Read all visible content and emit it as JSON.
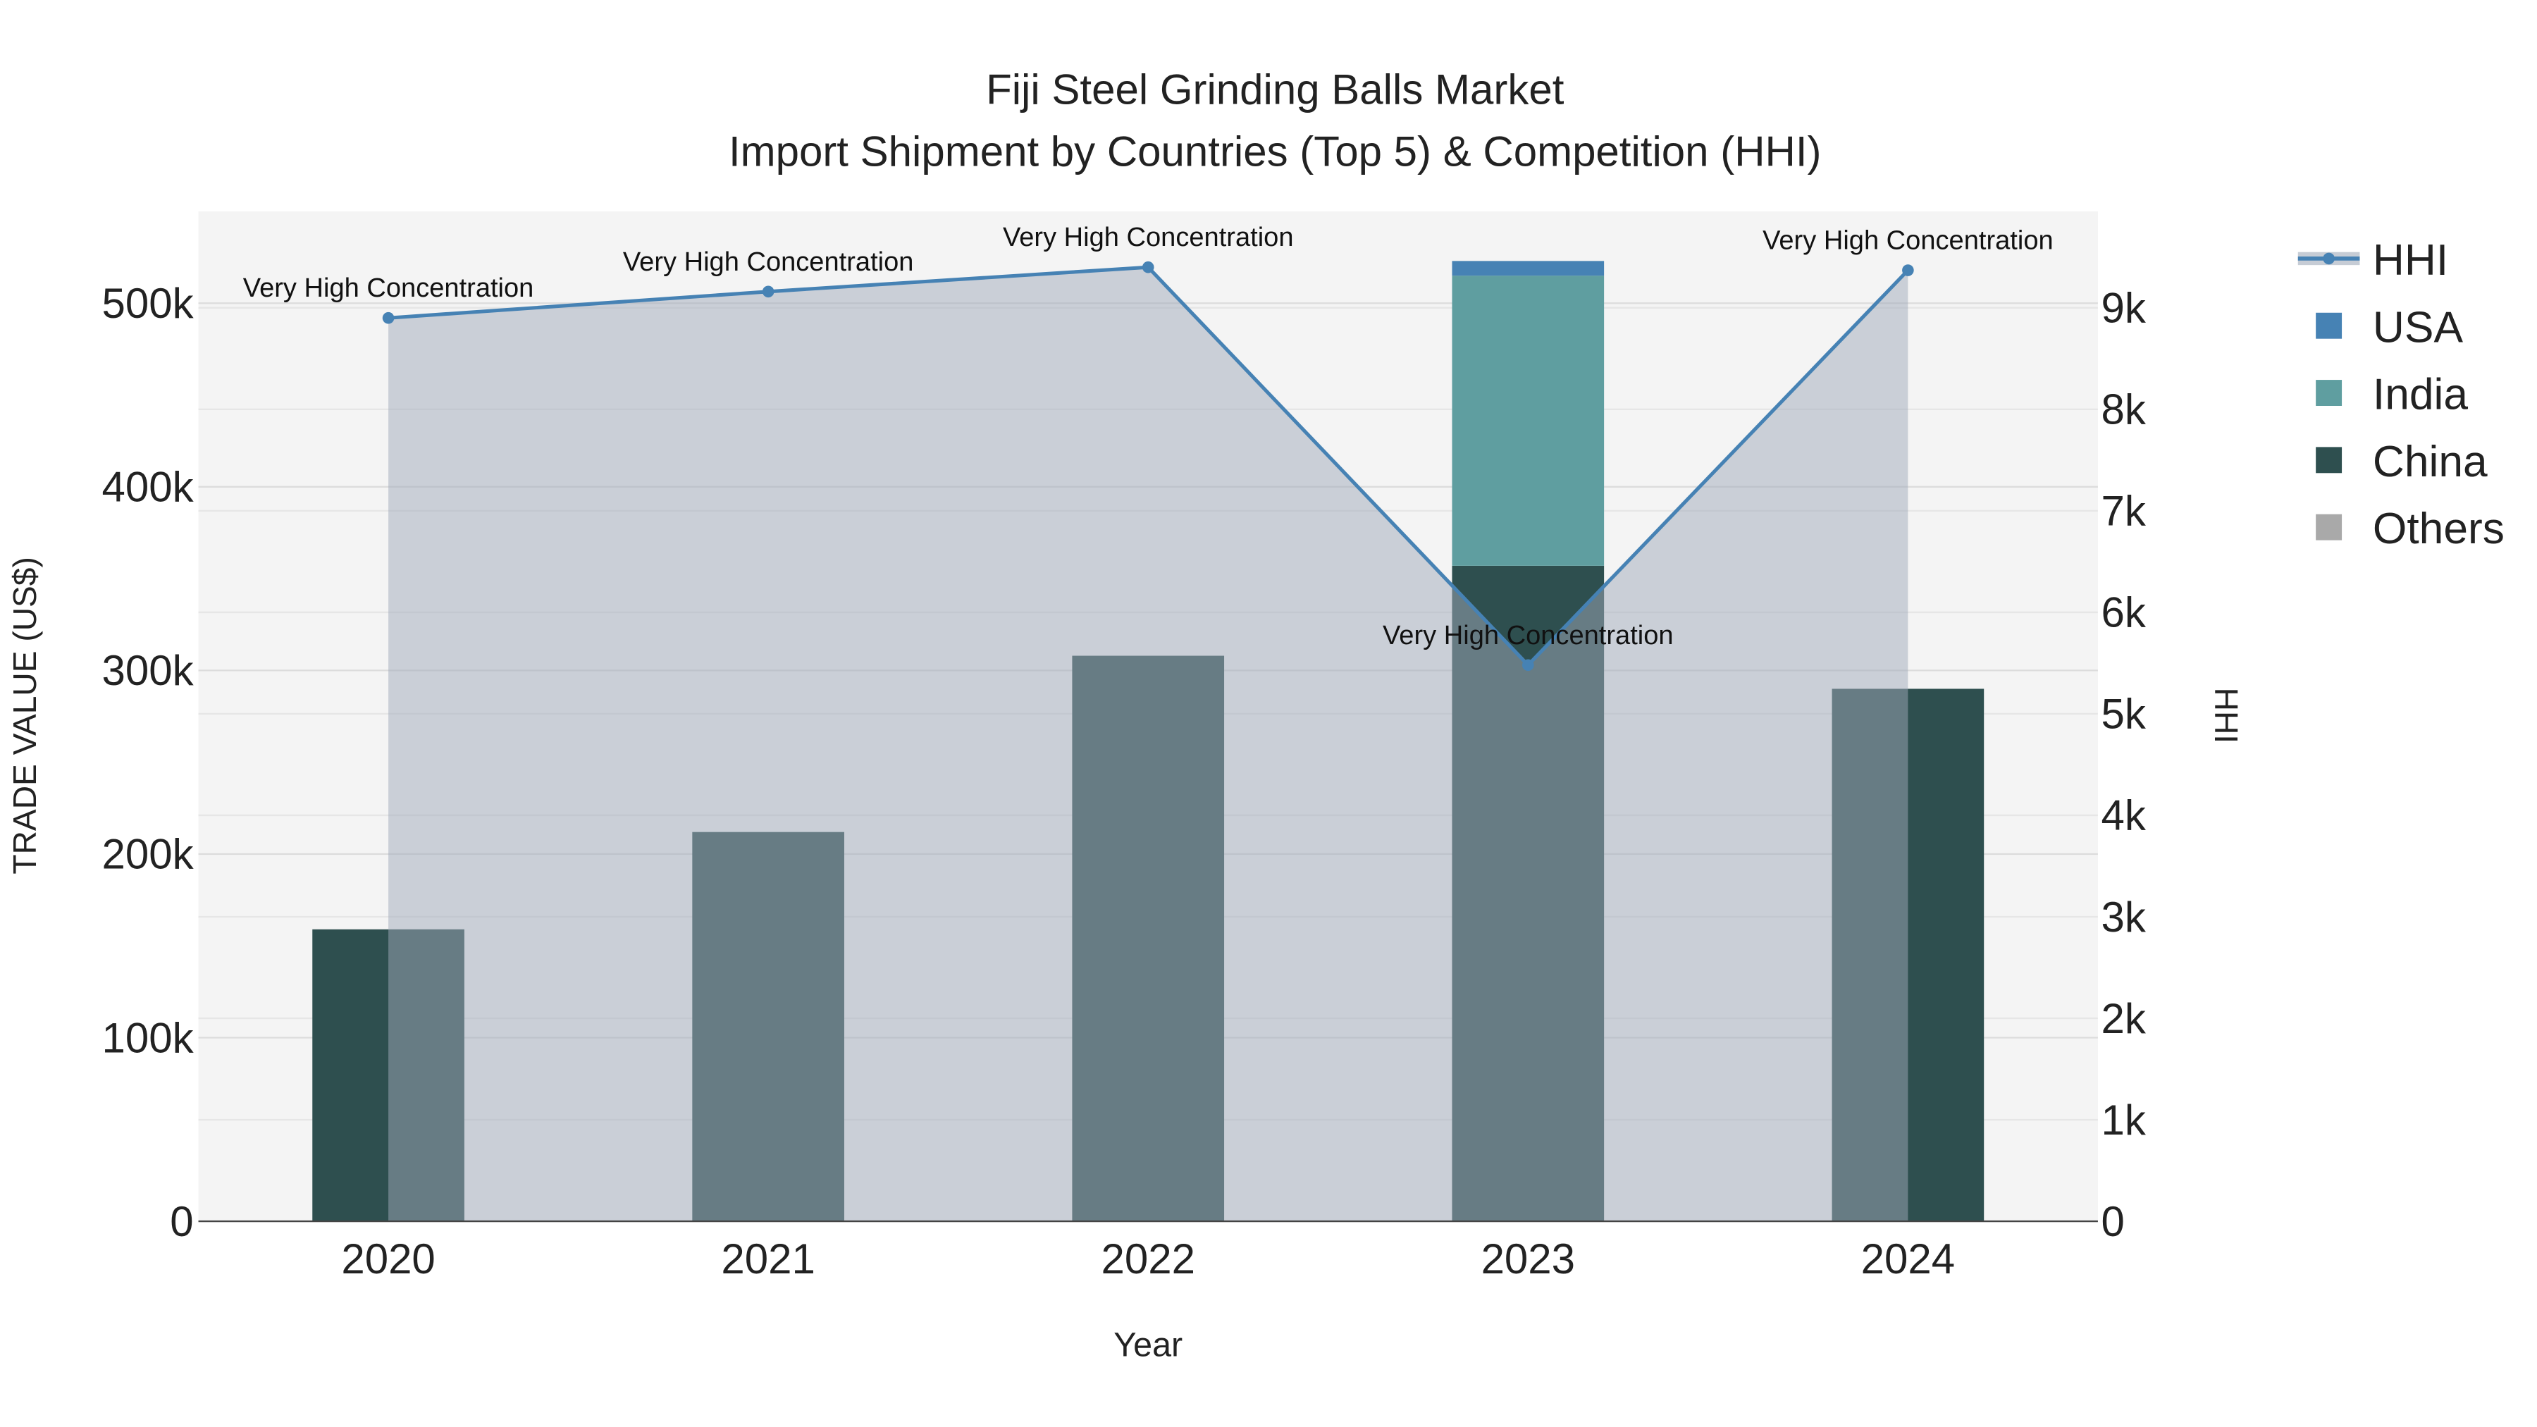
{
  "chart_data": {
    "type": "bar",
    "title": "Fiji Steel Grinding Balls Market",
    "subtitle": "Import Shipment by Countries (Top 5) & Competition (HHI)",
    "xlabel": "Year",
    "ylabel": "TRADE VALUE (US$)",
    "y2label": "HHI",
    "categories": [
      "2020",
      "2021",
      "2022",
      "2023",
      "2024"
    ],
    "ylim": [
      0,
      550000
    ],
    "y2lim": [
      0,
      9950
    ],
    "yticks": [
      {
        "v": 0,
        "label": "0"
      },
      {
        "v": 100000,
        "label": "100k"
      },
      {
        "v": 200000,
        "label": "200k"
      },
      {
        "v": 300000,
        "label": "300k"
      },
      {
        "v": 400000,
        "label": "400k"
      },
      {
        "v": 500000,
        "label": "500k"
      }
    ],
    "y2ticks": [
      {
        "v": 0,
        "label": "0"
      },
      {
        "v": 1000,
        "label": "1k"
      },
      {
        "v": 2000,
        "label": "2k"
      },
      {
        "v": 3000,
        "label": "3k"
      },
      {
        "v": 4000,
        "label": "4k"
      },
      {
        "v": 5000,
        "label": "5k"
      },
      {
        "v": 6000,
        "label": "6k"
      },
      {
        "v": 7000,
        "label": "7k"
      },
      {
        "v": 8000,
        "label": "8k"
      },
      {
        "v": 9000,
        "label": "9k"
      }
    ],
    "barmode": "stack",
    "series": [
      {
        "name": "China",
        "color": "#2e4f4f",
        "values": [
          159000,
          212000,
          308000,
          357000,
          290000
        ]
      },
      {
        "name": "India",
        "color": "#5f9ea0",
        "values": [
          0,
          0,
          0,
          158000,
          0
        ]
      },
      {
        "name": "USA",
        "color": "#4682b4",
        "values": [
          0,
          0,
          0,
          8000,
          0
        ]
      },
      {
        "name": "Others",
        "color": "#a9a9a9",
        "values": [
          0,
          0,
          0,
          0,
          0
        ]
      }
    ],
    "hhi": {
      "name": "HHI",
      "color": "#4682b4",
      "values": [
        8900,
        9160,
        9400,
        5480,
        9370
      ],
      "annotations": [
        "Very High Concentration",
        "Very High Concentration",
        "Very High Concentration",
        "Very High Concentration",
        "Very High Concentration"
      ]
    },
    "legend": {
      "placement": "right",
      "items": [
        "HHI",
        "USA",
        "India",
        "China",
        "Others"
      ]
    },
    "grid": true
  }
}
